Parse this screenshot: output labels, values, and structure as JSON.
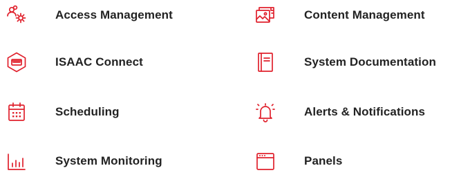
{
  "colors": {
    "accent": "#e0202c",
    "text": "#222222"
  },
  "menu": {
    "items": [
      {
        "label": "Access Management",
        "icon": "users-gear-icon"
      },
      {
        "label": "Content Management",
        "icon": "image-gallery-icon"
      },
      {
        "label": "ISAAC Connect",
        "icon": "hexagon-device-icon"
      },
      {
        "label": "System Documentation",
        "icon": "document-icon"
      },
      {
        "label": "Scheduling",
        "icon": "calendar-icon"
      },
      {
        "label": "Alerts & Notifications",
        "icon": "bell-alert-icon"
      },
      {
        "label": "System Monitoring",
        "icon": "bar-chart-icon"
      },
      {
        "label": "Panels",
        "icon": "window-panel-icon"
      }
    ]
  }
}
